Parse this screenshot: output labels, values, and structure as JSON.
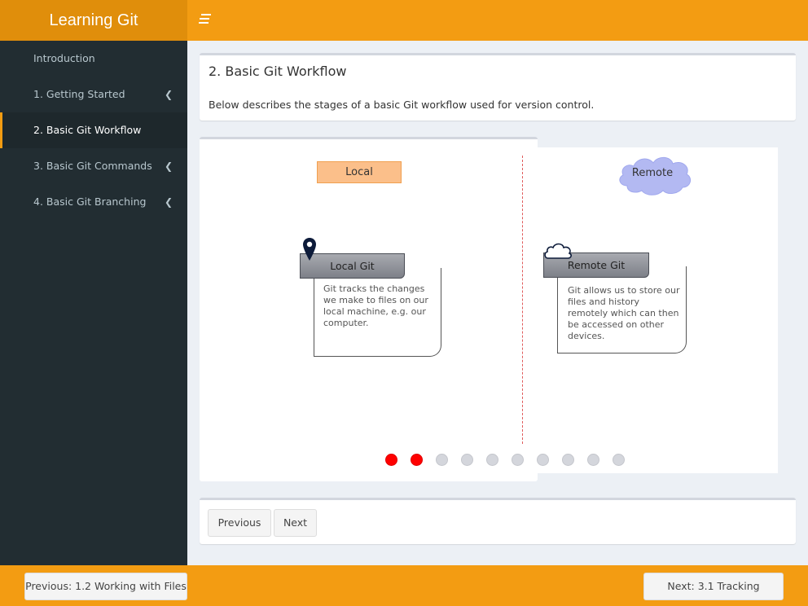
{
  "header": {
    "brand": "Learning Git"
  },
  "sidebar": {
    "items": [
      {
        "label": "Introduction"
      },
      {
        "label": "1. Getting Started"
      },
      {
        "label": "2. Basic Git Workflow"
      },
      {
        "label": "3. Basic Git Commands"
      },
      {
        "label": "4. Basic Git Branching"
      }
    ]
  },
  "main": {
    "title": "2. Basic Git Workflow",
    "description": "Below describes the stages of a basic Git workflow used for version control."
  },
  "diagram": {
    "local_tag": "Local",
    "remote_tag": "Remote",
    "local_card": {
      "title": "Local Git",
      "text": "Git tracks the changes we make to files on our local machine, e.g. our computer."
    },
    "remote_card": {
      "title": "Remote Git",
      "text": "Git allows us to store our files and history remotely which can then be accessed on other devices."
    },
    "slides": {
      "total": 10,
      "active": [
        1,
        2
      ]
    }
  },
  "pager": {
    "previous": "Previous",
    "next": "Next"
  },
  "footer": {
    "previous": "Previous: 1.2 Working with Files",
    "next": "Next: 3.1 Tracking Changes"
  },
  "colors": {
    "accent": "#f39c12",
    "sidebar": "#222d32",
    "dot_active": "#ff0000"
  }
}
